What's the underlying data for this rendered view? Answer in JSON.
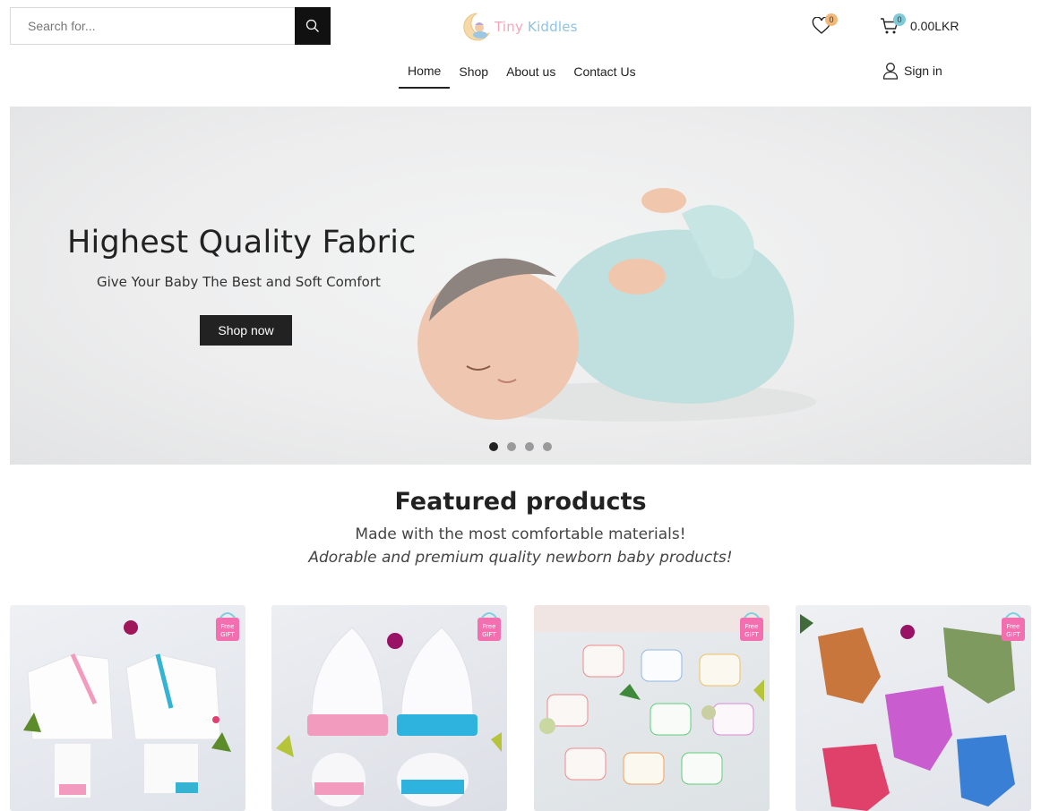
{
  "search": {
    "placeholder": "Search for..."
  },
  "logo": {
    "word1": "Tiny",
    "word2": "Kiddles"
  },
  "wishlist": {
    "count": "0"
  },
  "cart": {
    "count": "0",
    "total": "0.00LKR"
  },
  "nav": {
    "items": [
      "Home",
      "Shop",
      "About us",
      "Contact Us"
    ],
    "active": "Home"
  },
  "account": {
    "signin_label": "Sign in"
  },
  "hero": {
    "title": "Highest Quality Fabric",
    "subtitle": "Give Your Baby The Best and Soft Comfort",
    "button_label": "Shop now",
    "slide_count": 4,
    "active_slide": 1
  },
  "featured": {
    "title": "Featured products",
    "subtitle": "Made with the most comfortable materials!",
    "tagline": "Adorable and premium quality newborn baby products!"
  },
  "products": [
    {
      "badge": "Free GIFT"
    },
    {
      "badge": "Free GIFT"
    },
    {
      "badge": "Free GIFT"
    },
    {
      "badge": "Free GIFT"
    }
  ],
  "colors": {
    "accent_dark": "#222222",
    "logo_pink": "#f2a7b8",
    "logo_blue": "#8fc3e0",
    "wish_badge": "#f3b878",
    "cart_badge": "#7fcad8"
  }
}
